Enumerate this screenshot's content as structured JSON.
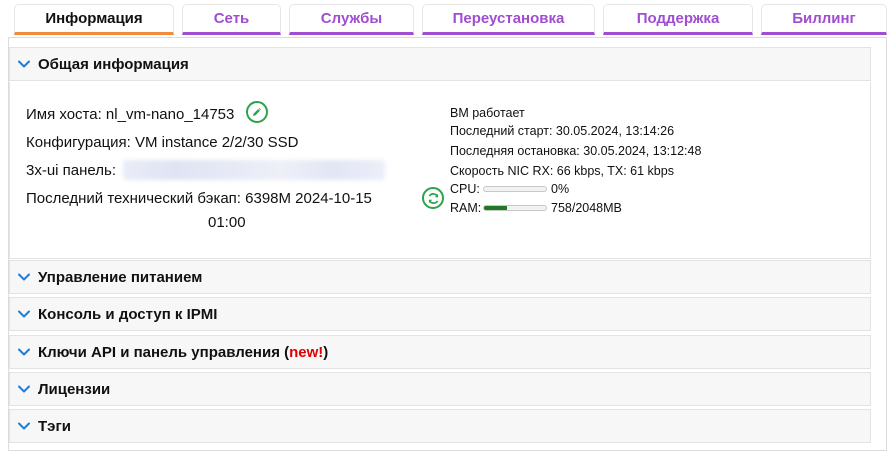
{
  "tabs": [
    {
      "label": "Информация",
      "active": true
    },
    {
      "label": "Сеть"
    },
    {
      "label": "Службы"
    },
    {
      "label": "Переустановка"
    },
    {
      "label": "Поддержка"
    },
    {
      "label": "Биллинг"
    }
  ],
  "general": {
    "title": "Общая информация",
    "hostname_label": "Имя хоста: nl_vm-nano_14753",
    "config_label": "Конфигурация: VM instance 2/2/30 SSD",
    "panel_label": "3x-ui панель:",
    "backup_line1": "Последний технический бэкап: 6398M 2024-10-15",
    "backup_line2": "01:00",
    "status": "ВМ работает",
    "last_start": "Последний старт: 30.05.2024, 13:14:26",
    "last_stop": "Последняя остановка: 30.05.2024, 13:12:48",
    "nic_speed": "Скорость NIC RX: 66 kbps, TX: 61 kbps",
    "cpu_label": "CPU:",
    "cpu_value": "0%",
    "cpu_fraction": 0.0,
    "ram_label": "RAM:",
    "ram_value": "758/2048MB",
    "ram_fraction": 0.37
  },
  "sections": {
    "power": "Управление питанием",
    "console": "Консоль и доступ к IPMI",
    "api": "Ключи API и панель управления (",
    "api_new": "new!",
    "api_close": ")",
    "licenses": "Лицензии",
    "tags": "Тэги"
  },
  "colors": {
    "accent_purple": "#a04dd0",
    "active_tab_underline": "#f08a3c",
    "chevron_blue": "#1e7fd6",
    "action_green": "#2aa34a",
    "new_red": "#e00000"
  },
  "icons": {
    "chevron": "chevron-down-icon",
    "edit": "pencil-icon",
    "refresh": "refresh-icon"
  }
}
